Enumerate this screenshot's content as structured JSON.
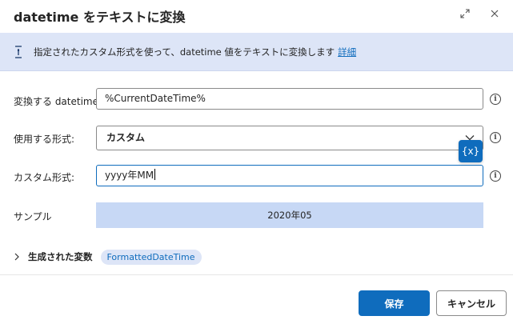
{
  "dialog": {
    "title": "datetime をテキストに変換"
  },
  "banner": {
    "text": "指定されたカスタム形式を使って、datetime 値をテキストに変換します",
    "link": "詳細"
  },
  "fields": {
    "datetime_label": "変換する datetime:",
    "datetime_value": "%CurrentDateTime%",
    "format_label": "使用する形式:",
    "format_value": "カスタム",
    "custom_label": "カスタム形式:",
    "custom_value": "yyyy年MM",
    "sample_label": "サンプル",
    "sample_value": "2020年05",
    "var_button": "{x}",
    "info_glyph": "i"
  },
  "generated": {
    "label": "生成された変数",
    "variable": "FormattedDateTime"
  },
  "footer": {
    "save": "保存",
    "cancel": "キャンセル"
  },
  "icons": [
    "expand-icon",
    "close-icon",
    "info-icon",
    "chevron-down-icon",
    "chevron-right-icon",
    "variable-icon"
  ],
  "colors": {
    "accent": "#0f6cbd",
    "banner_bg": "#dde5f7",
    "sample_bg": "#c7d8f5"
  }
}
